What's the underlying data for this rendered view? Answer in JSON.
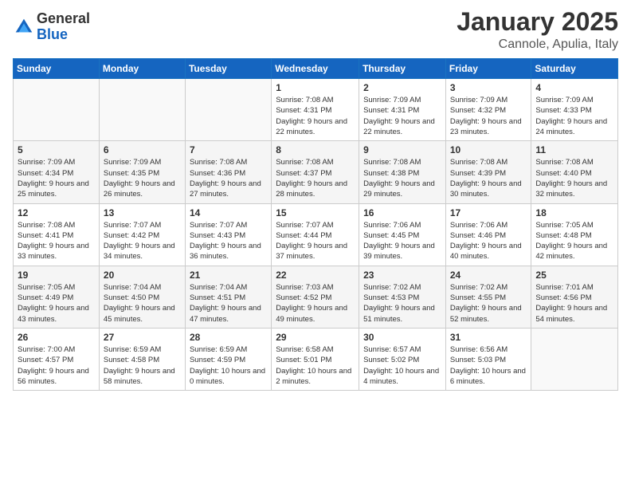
{
  "logo": {
    "general": "General",
    "blue": "Blue"
  },
  "header": {
    "month": "January 2025",
    "location": "Cannole, Apulia, Italy"
  },
  "weekdays": [
    "Sunday",
    "Monday",
    "Tuesday",
    "Wednesday",
    "Thursday",
    "Friday",
    "Saturday"
  ],
  "weeks": [
    [
      {
        "day": "",
        "sunrise": "",
        "sunset": "",
        "daylight": ""
      },
      {
        "day": "",
        "sunrise": "",
        "sunset": "",
        "daylight": ""
      },
      {
        "day": "",
        "sunrise": "",
        "sunset": "",
        "daylight": ""
      },
      {
        "day": "1",
        "sunrise": "Sunrise: 7:08 AM",
        "sunset": "Sunset: 4:31 PM",
        "daylight": "Daylight: 9 hours and 22 minutes."
      },
      {
        "day": "2",
        "sunrise": "Sunrise: 7:09 AM",
        "sunset": "Sunset: 4:31 PM",
        "daylight": "Daylight: 9 hours and 22 minutes."
      },
      {
        "day": "3",
        "sunrise": "Sunrise: 7:09 AM",
        "sunset": "Sunset: 4:32 PM",
        "daylight": "Daylight: 9 hours and 23 minutes."
      },
      {
        "day": "4",
        "sunrise": "Sunrise: 7:09 AM",
        "sunset": "Sunset: 4:33 PM",
        "daylight": "Daylight: 9 hours and 24 minutes."
      }
    ],
    [
      {
        "day": "5",
        "sunrise": "Sunrise: 7:09 AM",
        "sunset": "Sunset: 4:34 PM",
        "daylight": "Daylight: 9 hours and 25 minutes."
      },
      {
        "day": "6",
        "sunrise": "Sunrise: 7:09 AM",
        "sunset": "Sunset: 4:35 PM",
        "daylight": "Daylight: 9 hours and 26 minutes."
      },
      {
        "day": "7",
        "sunrise": "Sunrise: 7:08 AM",
        "sunset": "Sunset: 4:36 PM",
        "daylight": "Daylight: 9 hours and 27 minutes."
      },
      {
        "day": "8",
        "sunrise": "Sunrise: 7:08 AM",
        "sunset": "Sunset: 4:37 PM",
        "daylight": "Daylight: 9 hours and 28 minutes."
      },
      {
        "day": "9",
        "sunrise": "Sunrise: 7:08 AM",
        "sunset": "Sunset: 4:38 PM",
        "daylight": "Daylight: 9 hours and 29 minutes."
      },
      {
        "day": "10",
        "sunrise": "Sunrise: 7:08 AM",
        "sunset": "Sunset: 4:39 PM",
        "daylight": "Daylight: 9 hours and 30 minutes."
      },
      {
        "day": "11",
        "sunrise": "Sunrise: 7:08 AM",
        "sunset": "Sunset: 4:40 PM",
        "daylight": "Daylight: 9 hours and 32 minutes."
      }
    ],
    [
      {
        "day": "12",
        "sunrise": "Sunrise: 7:08 AM",
        "sunset": "Sunset: 4:41 PM",
        "daylight": "Daylight: 9 hours and 33 minutes."
      },
      {
        "day": "13",
        "sunrise": "Sunrise: 7:07 AM",
        "sunset": "Sunset: 4:42 PM",
        "daylight": "Daylight: 9 hours and 34 minutes."
      },
      {
        "day": "14",
        "sunrise": "Sunrise: 7:07 AM",
        "sunset": "Sunset: 4:43 PM",
        "daylight": "Daylight: 9 hours and 36 minutes."
      },
      {
        "day": "15",
        "sunrise": "Sunrise: 7:07 AM",
        "sunset": "Sunset: 4:44 PM",
        "daylight": "Daylight: 9 hours and 37 minutes."
      },
      {
        "day": "16",
        "sunrise": "Sunrise: 7:06 AM",
        "sunset": "Sunset: 4:45 PM",
        "daylight": "Daylight: 9 hours and 39 minutes."
      },
      {
        "day": "17",
        "sunrise": "Sunrise: 7:06 AM",
        "sunset": "Sunset: 4:46 PM",
        "daylight": "Daylight: 9 hours and 40 minutes."
      },
      {
        "day": "18",
        "sunrise": "Sunrise: 7:05 AM",
        "sunset": "Sunset: 4:48 PM",
        "daylight": "Daylight: 9 hours and 42 minutes."
      }
    ],
    [
      {
        "day": "19",
        "sunrise": "Sunrise: 7:05 AM",
        "sunset": "Sunset: 4:49 PM",
        "daylight": "Daylight: 9 hours and 43 minutes."
      },
      {
        "day": "20",
        "sunrise": "Sunrise: 7:04 AM",
        "sunset": "Sunset: 4:50 PM",
        "daylight": "Daylight: 9 hours and 45 minutes."
      },
      {
        "day": "21",
        "sunrise": "Sunrise: 7:04 AM",
        "sunset": "Sunset: 4:51 PM",
        "daylight": "Daylight: 9 hours and 47 minutes."
      },
      {
        "day": "22",
        "sunrise": "Sunrise: 7:03 AM",
        "sunset": "Sunset: 4:52 PM",
        "daylight": "Daylight: 9 hours and 49 minutes."
      },
      {
        "day": "23",
        "sunrise": "Sunrise: 7:02 AM",
        "sunset": "Sunset: 4:53 PM",
        "daylight": "Daylight: 9 hours and 51 minutes."
      },
      {
        "day": "24",
        "sunrise": "Sunrise: 7:02 AM",
        "sunset": "Sunset: 4:55 PM",
        "daylight": "Daylight: 9 hours and 52 minutes."
      },
      {
        "day": "25",
        "sunrise": "Sunrise: 7:01 AM",
        "sunset": "Sunset: 4:56 PM",
        "daylight": "Daylight: 9 hours and 54 minutes."
      }
    ],
    [
      {
        "day": "26",
        "sunrise": "Sunrise: 7:00 AM",
        "sunset": "Sunset: 4:57 PM",
        "daylight": "Daylight: 9 hours and 56 minutes."
      },
      {
        "day": "27",
        "sunrise": "Sunrise: 6:59 AM",
        "sunset": "Sunset: 4:58 PM",
        "daylight": "Daylight: 9 hours and 58 minutes."
      },
      {
        "day": "28",
        "sunrise": "Sunrise: 6:59 AM",
        "sunset": "Sunset: 4:59 PM",
        "daylight": "Daylight: 10 hours and 0 minutes."
      },
      {
        "day": "29",
        "sunrise": "Sunrise: 6:58 AM",
        "sunset": "Sunset: 5:01 PM",
        "daylight": "Daylight: 10 hours and 2 minutes."
      },
      {
        "day": "30",
        "sunrise": "Sunrise: 6:57 AM",
        "sunset": "Sunset: 5:02 PM",
        "daylight": "Daylight: 10 hours and 4 minutes."
      },
      {
        "day": "31",
        "sunrise": "Sunrise: 6:56 AM",
        "sunset": "Sunset: 5:03 PM",
        "daylight": "Daylight: 10 hours and 6 minutes."
      },
      {
        "day": "",
        "sunrise": "",
        "sunset": "",
        "daylight": ""
      }
    ]
  ]
}
